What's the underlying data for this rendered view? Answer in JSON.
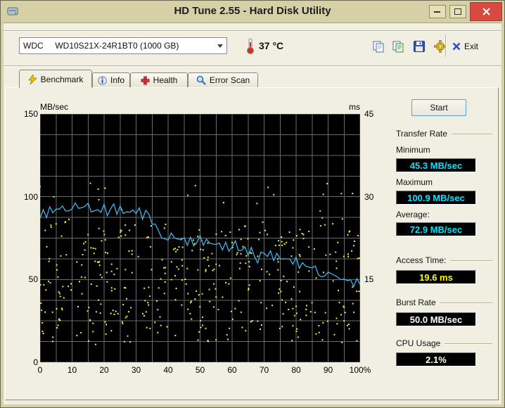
{
  "window": {
    "title": "HD Tune 2.55 - Hard Disk Utility"
  },
  "toolbar": {
    "device": "WDC     WD10S21X-24R1BT0 (1000 GB)",
    "temperature": "37 °C",
    "exit_label": "Exit"
  },
  "tabs": [
    {
      "label": "Benchmark",
      "active": true
    },
    {
      "label": "Info",
      "active": false
    },
    {
      "label": "Health",
      "active": false
    },
    {
      "label": "Error Scan",
      "active": false
    }
  ],
  "results": {
    "start_label": "Start",
    "transfer_rate": {
      "title": "Transfer Rate",
      "rows": [
        {
          "label": "Minimum",
          "value": "45.3 MB/sec"
        },
        {
          "label": "Maximum",
          "value": "100.9 MB/sec"
        },
        {
          "label": "Average:",
          "value": "72.9 MB/sec"
        }
      ]
    },
    "access_time": {
      "label": "Access Time:",
      "value": "19.6 ms"
    },
    "burst_rate": {
      "label": "Burst Rate",
      "value": "50.0 MB/sec"
    },
    "cpu_usage": {
      "label": "CPU Usage",
      "value": "2.1%"
    }
  },
  "colors": {
    "value_cyan": "#00e5ff",
    "value_yellow": "#ffff00",
    "value_white": "#ffffff",
    "titlebar": "#d6d0a6",
    "close_red": "#d9493f"
  },
  "chart_data": {
    "type": "line+scatter",
    "plot_bg": "#000000",
    "grid_color": "#6a6a6a",
    "x_axis": {
      "range": [
        0,
        100
      ],
      "grid_step": 5,
      "tick_labels": [
        "0",
        "10",
        "20",
        "30",
        "40",
        "50",
        "60",
        "70",
        "80",
        "90",
        "100%"
      ]
    },
    "y_left": {
      "label": "MB/sec",
      "range": [
        0,
        150
      ],
      "grid_step": 12.5,
      "ticks": [
        150,
        100,
        50,
        0
      ]
    },
    "y_right": {
      "label": "ms",
      "range": [
        0,
        45
      ],
      "ticks": [
        45,
        30,
        15
      ]
    },
    "series": [
      {
        "name": "Transfer rate (MB/sec)",
        "type": "line",
        "axis": "left",
        "color": "#3fb4ea",
        "x_step": 1,
        "y": [
          87,
          91,
          89,
          93,
          90,
          94,
          91,
          95,
          92,
          90,
          94,
          96,
          92,
          95,
          93,
          96,
          92,
          90,
          93,
          91,
          94,
          90,
          92,
          95,
          91,
          93,
          90,
          92,
          89,
          93,
          90,
          92,
          88,
          91,
          89,
          85,
          82,
          80,
          76,
          73,
          75,
          78,
          74,
          76,
          73,
          75,
          72,
          74,
          71,
          73,
          75,
          72,
          74,
          71,
          73,
          70,
          72,
          69,
          71,
          68,
          70,
          72,
          69,
          67,
          69,
          66,
          68,
          64,
          61,
          65,
          67,
          64,
          66,
          63,
          65,
          62,
          64,
          61,
          63,
          60,
          62,
          58,
          60,
          57,
          59,
          56,
          58,
          54,
          50,
          53,
          55,
          52,
          54,
          51,
          49,
          52,
          48,
          50,
          47,
          49,
          48
        ]
      },
      {
        "name": "Access time (ms)",
        "type": "scatter",
        "axis": "right",
        "color": "#f0f040",
        "seed": 987654321,
        "count": 430,
        "low_prob": 0.8,
        "band_low": [
          3,
          25
        ],
        "band_high": [
          3,
          34
        ]
      }
    ]
  }
}
